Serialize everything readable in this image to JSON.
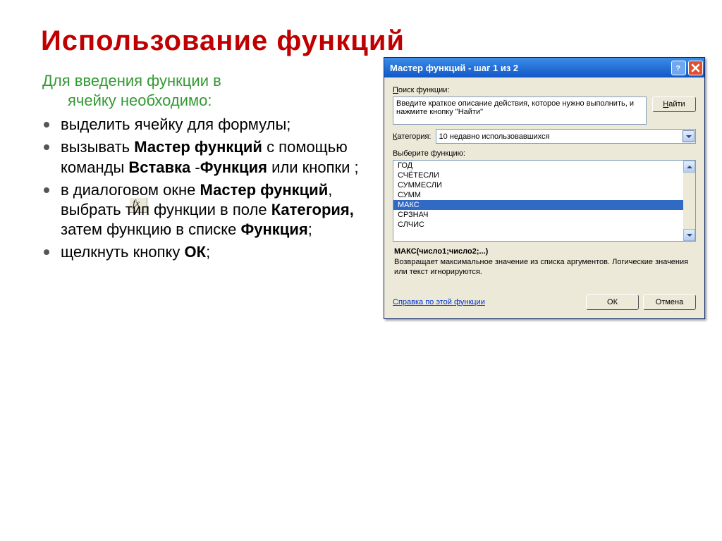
{
  "slide": {
    "title": "Использование функций",
    "intro_line1": "Для введения функции в",
    "intro_line2": "ячейку необходимо:",
    "bullets": {
      "b1": "выделить ячейку для формулы;",
      "b2_pre": "вызывать ",
      "b2_bold1": "Мастер функций",
      "b2_mid": " с помощью команды ",
      "b2_bold2": "Вставка",
      "b2_dash": " -",
      "b2_bold3": "Функция",
      "b2_post": " или кнопки           ;",
      "b3_pre": "в диалоговом окне ",
      "b3_bold1": "Мастер функций",
      "b3_mid1": ", выбрать тип функции в поле ",
      "b3_bold2": "Категория,",
      "b3_mid2": " затем функцию в списке ",
      "b3_bold3": "Функция",
      "b3_post": ";",
      "b4_pre": "щелкнуть кнопку ",
      "b4_bold": "ОК",
      "b4_post": ";"
    }
  },
  "dialog": {
    "title": "Мастер функций - шаг 1 из 2",
    "search_label_pref": "П",
    "search_label_rest": "оиск функции:",
    "search_text": "Введите краткое описание действия, которое нужно выполнить, и нажмите кнопку \"Найти\"",
    "find_button": "Найти",
    "category_label_pref": "К",
    "category_label_rest": "атегория:",
    "category_value": "10 недавно использовавшихся",
    "select_label": "Выберите функцию:",
    "functions": [
      "ГОД",
      "СЧЁТЕСЛИ",
      "СУММЕСЛИ",
      "СУММ",
      "МАКС",
      "СРЗНАЧ",
      "СЛЧИС"
    ],
    "selected_index": 4,
    "signature": "МАКС(число1;число2;...)",
    "description": "Возвращает максимальное значение из списка аргументов. Логические значения или текст игнорируются.",
    "help_link": "Справка по этой функции",
    "ok": "ОК",
    "cancel": "Отмена"
  }
}
